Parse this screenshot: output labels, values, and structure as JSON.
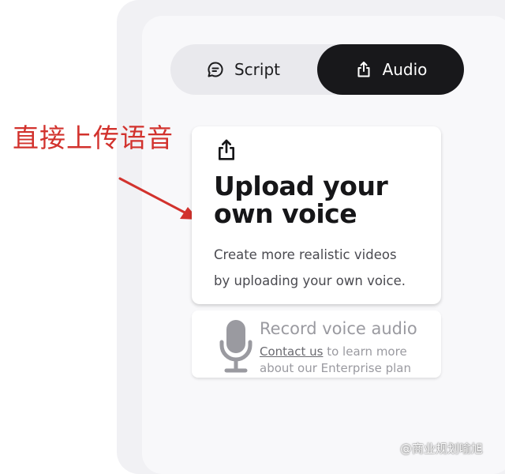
{
  "tabs": {
    "script": {
      "label": "Script",
      "icon": "chat-bubble-icon"
    },
    "audio": {
      "label": "Audio",
      "icon": "upload-share-icon",
      "active": true
    }
  },
  "annotation": {
    "text": "直接上传语音",
    "color": "#d2322d"
  },
  "upload_card": {
    "icon": "upload-share-icon",
    "title_line1": "Upload your",
    "title_line2": "own voice",
    "description_line1": "Create more realistic videos",
    "description_line2": "by uploading your own voice."
  },
  "record_card": {
    "icon": "microphone-icon",
    "title": "Record voice audio",
    "link_text": "Contact us",
    "desc_rest": " to learn more about our Enterprise plan"
  },
  "watermark": "@商业规划喻旭",
  "colors": {
    "accent_dark": "#18181b",
    "annotation_red": "#d2322d",
    "muted_text": "#9a9aa0"
  }
}
